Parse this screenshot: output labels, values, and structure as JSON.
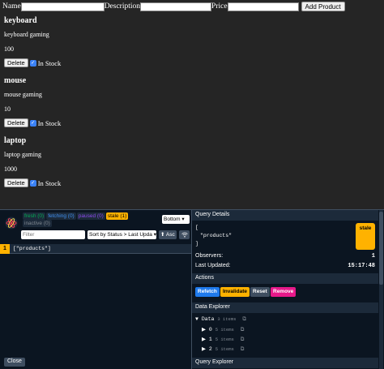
{
  "form": {
    "name_label": "Name",
    "description_label": "Description",
    "price_label": "Price",
    "add_button": "Add Product"
  },
  "products": [
    {
      "name": "keyboard",
      "description": "keyboard gaming",
      "price": "100",
      "delete_label": "Delete",
      "in_stock_label": "In Stock"
    },
    {
      "name": "mouse",
      "description": "mouse gaming",
      "price": "10",
      "delete_label": "Delete",
      "in_stock_label": "In Stock"
    },
    {
      "name": "laptop",
      "description": "laptop gaming",
      "price": "1000",
      "delete_label": "Delete",
      "in_stock_label": "In Stock"
    }
  ],
  "devtools": {
    "badges": {
      "fresh": "fresh (0)",
      "fetching": "fetching (0)",
      "paused": "paused (0)",
      "stale": "stale (1)",
      "inactive": "inactive (0)"
    },
    "position_select": "Bottom",
    "filter_placeholder": "Filter",
    "sort_select": "Sort by Status > Last Upda",
    "asc_button": "⬆ Asc",
    "query": {
      "count": "1",
      "key": "[\"products\"]"
    },
    "close_button": "Close",
    "details": {
      "title": "Query Details",
      "key_line1": "[",
      "key_line2": "\"products\"",
      "key_line3": "]",
      "status": "stale",
      "observers_label": "Observers:",
      "observers_value": "1",
      "last_updated_label": "Last Updated:",
      "last_updated_value": "15:17:48"
    },
    "actions": {
      "title": "Actions",
      "refetch": "Refetch",
      "invalidate": "Invalidate",
      "reset": "Reset",
      "remove": "Remove"
    },
    "data_explorer": {
      "title": "Data Explorer",
      "root_label": "Data",
      "root_count": "3 items",
      "items": [
        {
          "index": "0",
          "count": "5 items"
        },
        {
          "index": "1",
          "count": "5 items"
        },
        {
          "index": "2",
          "count": "5 items"
        }
      ]
    },
    "query_explorer_title": "Query Explorer"
  },
  "colors": {
    "fresh": "#00ab52",
    "fetching": "#3f8ff0",
    "paused": "#8c49eb",
    "stale": "#ffb200",
    "refetch": "#1f7aec",
    "invalidate": "#ffb200",
    "reset": "#3f4e60",
    "remove": "#e7198a"
  }
}
